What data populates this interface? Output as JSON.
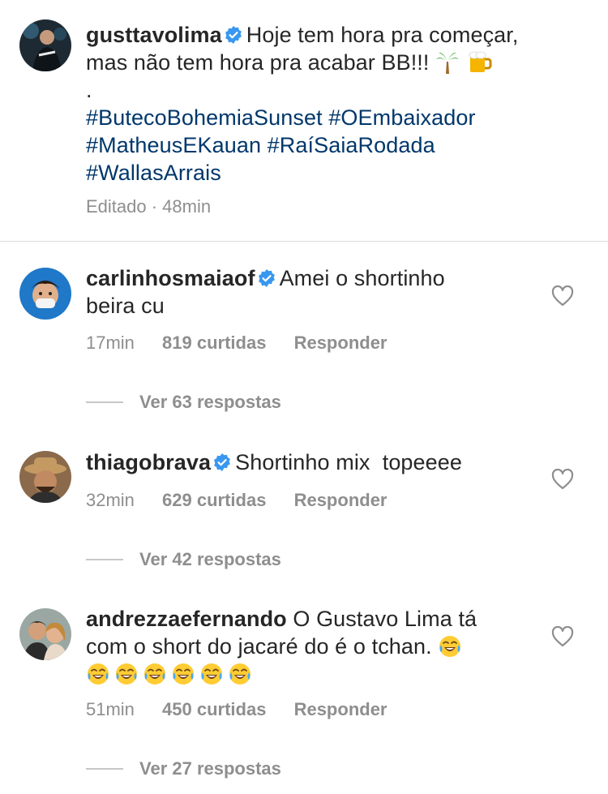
{
  "post": {
    "username": "gusttavolima",
    "caption_line1": "Hoje tem hora pra começar,",
    "caption_line2": "mas não tem hora pra acabar BB!!!",
    "dot": ".",
    "hashtags": [
      "#ButecoBohemiaSunset",
      "#OEmbaixador",
      "#MatheusEKauan",
      "#RaíSaiaRodada",
      "#WallasArrais"
    ],
    "edited": "Editado · 48min"
  },
  "comments": [
    {
      "username": "carlinhosmaiaof",
      "verified": true,
      "text_line1": "Amei o shortinho",
      "text_line2": "beira cu",
      "time": "17min",
      "likes": "819 curtidas",
      "reply": "Responder",
      "view_replies": "Ver 63 respostas"
    },
    {
      "username": "thiagobrava",
      "verified": true,
      "text_line1": "Shortinho mix  topeeee",
      "time": "32min",
      "likes": "629 curtidas",
      "reply": "Responder",
      "view_replies": "Ver 42 respostas"
    },
    {
      "username": "andrezzaefernando",
      "verified": false,
      "text_line1": "O Gustavo Lima tá",
      "text_line2": "com o short do jacaré do é o tchan.",
      "emoji_count_line2": 1,
      "emoji_count_line3": 6,
      "time": "51min",
      "likes": "450 curtidas",
      "reply": "Responder",
      "view_replies": "Ver 27 respostas"
    }
  ],
  "icons": {
    "verified": "verified-badge-icon",
    "heart": "heart-outline-icon",
    "palm": "palm-tree-emoji",
    "beer": "beer-mug-emoji",
    "laugh": "tears-of-joy-emoji"
  },
  "colors": {
    "text": "#262626",
    "secondary": "#8e8e8e",
    "hashtag": "#00376b",
    "verified": "#3897f0"
  }
}
